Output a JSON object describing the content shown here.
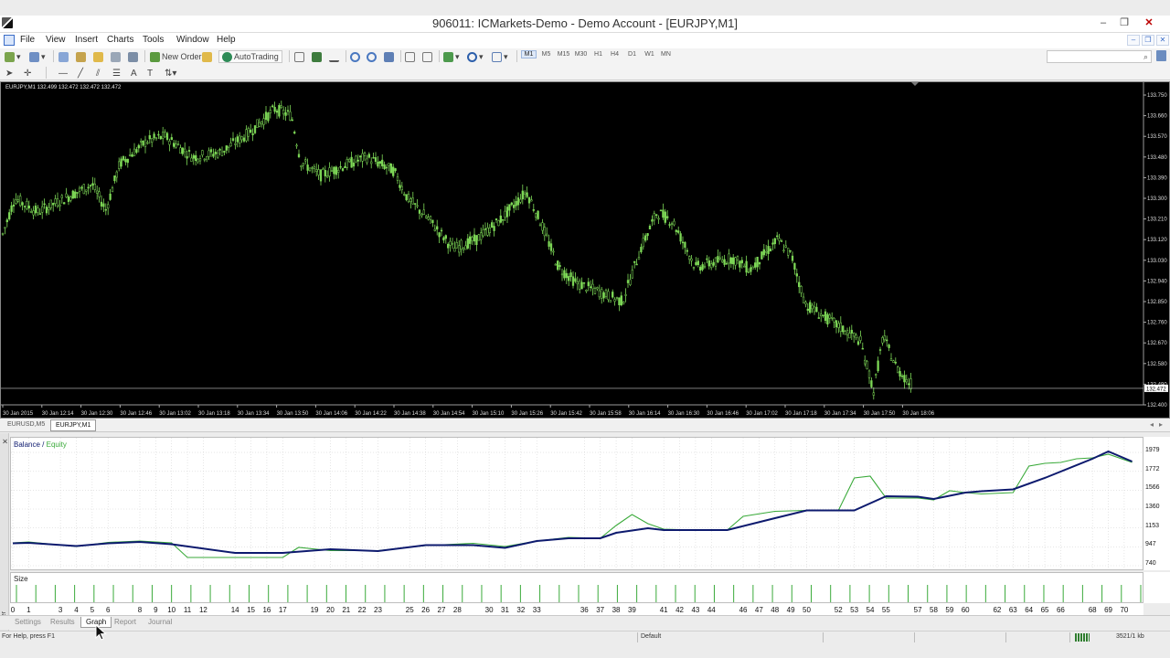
{
  "window": {
    "title": "906011: ICMarkets-Demo - Demo Account - [EURJPY,M1]",
    "controls": [
      "–",
      "❐",
      "✕"
    ],
    "mdi_controls": [
      "–",
      "❐",
      "✕"
    ]
  },
  "menu": [
    "File",
    "View",
    "Insert",
    "Charts",
    "Tools",
    "Window",
    "Help"
  ],
  "toolbar": {
    "new_order": "New Order",
    "autotrading": "AutoTrading",
    "timeframes": [
      "M1",
      "M5",
      "M15",
      "M30",
      "H1",
      "H4",
      "D1",
      "W1",
      "MN"
    ],
    "active_timeframe": "M1",
    "search_icon": "⌕"
  },
  "chart": {
    "info_label": "EURJPY,M1  132.499 132.472 132.472 132.472",
    "current_price": "132.472",
    "price_labels": [
      "133.750",
      "133.660",
      "133.570",
      "133.480",
      "133.390",
      "133.300",
      "133.210",
      "133.120",
      "133.030",
      "132.940",
      "132.850",
      "132.760",
      "132.670",
      "132.580",
      "132.490",
      "132.400"
    ],
    "time_labels": [
      "30 Jan 2015",
      "30 Jan 12:14",
      "30 Jan 12:30",
      "30 Jan 12:46",
      "30 Jan 13:02",
      "30 Jan 13:18",
      "30 Jan 13:34",
      "30 Jan 13:50",
      "30 Jan 14:06",
      "30 Jan 14:22",
      "30 Jan 14:38",
      "30 Jan 14:54",
      "30 Jan 15:10",
      "30 Jan 15:26",
      "30 Jan 15:42",
      "30 Jan 15:58",
      "30 Jan 16:14",
      "30 Jan 16:30",
      "30 Jan 16:46",
      "30 Jan 17:02",
      "30 Jan 17:18",
      "30 Jan 17:34",
      "30 Jan 17:50",
      "30 Jan 18:06"
    ],
    "candle_color": "#7ed957",
    "price_line_color": "#c9c9c9"
  },
  "chart_data": {
    "type": "line",
    "title": "Balance / Equity",
    "legend": {
      "balance": "Balance",
      "separator": "/",
      "equity": "Equity"
    },
    "ylim": [
      740,
      2060
    ],
    "y_ticks": [
      1979,
      1772,
      1566,
      1360,
      1153,
      947,
      740
    ],
    "x_ticks": [
      0,
      1,
      3,
      4,
      5,
      6,
      8,
      9,
      10,
      11,
      12,
      14,
      15,
      16,
      17,
      19,
      20,
      21,
      22,
      23,
      25,
      26,
      27,
      28,
      30,
      31,
      32,
      33,
      36,
      37,
      38,
      39,
      41,
      42,
      43,
      44,
      46,
      47,
      48,
      49,
      50,
      52,
      53,
      54,
      55,
      57,
      58,
      59,
      60,
      62,
      63,
      64,
      65,
      66,
      68,
      69,
      70
    ],
    "series": [
      {
        "name": "Balance",
        "color": "#0d1a6e",
        "x": [
          0,
          1,
          4,
          6,
          8,
          10,
          14,
          17,
          20,
          23,
          26,
          29,
          31,
          33,
          35,
          37,
          38,
          40,
          41,
          43,
          45,
          48,
          50,
          52,
          53,
          55,
          57,
          58,
          60,
          61,
          63,
          65,
          68,
          69,
          70.5
        ],
        "y": [
          985,
          990,
          955,
          985,
          1000,
          975,
          880,
          880,
          920,
          900,
          965,
          965,
          935,
          1010,
          1040,
          1040,
          1100,
          1150,
          1130,
          1130,
          1130,
          1260,
          1345,
          1345,
          1345,
          1500,
          1495,
          1470,
          1540,
          1555,
          1575,
          1700,
          1910,
          1990,
          1880
        ]
      },
      {
        "name": "Equity",
        "color": "#3aaa3a",
        "x": [
          0,
          1,
          4,
          6,
          8,
          10,
          11,
          14,
          17,
          18,
          20,
          23,
          26,
          29,
          31,
          33,
          35,
          37,
          38,
          39,
          40,
          41,
          43,
          45,
          46,
          48,
          50,
          52,
          53,
          54,
          55,
          57,
          58,
          59,
          60,
          61,
          63,
          64,
          65,
          66,
          67,
          68,
          69,
          70.5
        ],
        "y": [
          990,
          1000,
          950,
          995,
          1010,
          990,
          830,
          830,
          830,
          940,
          905,
          905,
          960,
          985,
          950,
          1010,
          1050,
          1040,
          1180,
          1300,
          1200,
          1140,
          1130,
          1130,
          1280,
          1335,
          1345,
          1345,
          1700,
          1720,
          1480,
          1480,
          1460,
          1560,
          1540,
          1525,
          1540,
          1830,
          1860,
          1870,
          1910,
          1920,
          1960,
          1870
        ]
      }
    ],
    "size_panel": {
      "label": "Size",
      "bars": 59
    }
  },
  "symbol_tabs": [
    "EURUSD,M5",
    "EURJPY,M1"
  ],
  "active_symbol_tab": "EURJPY,M1",
  "tester": {
    "side_label": "Tester",
    "tabs": [
      "Settings",
      "Results",
      "Graph",
      "Report",
      "Journal"
    ],
    "active_tab": "Graph"
  },
  "status": {
    "help": "For Help, press F1",
    "profile": "Default",
    "traffic": "3521/1 kb"
  }
}
